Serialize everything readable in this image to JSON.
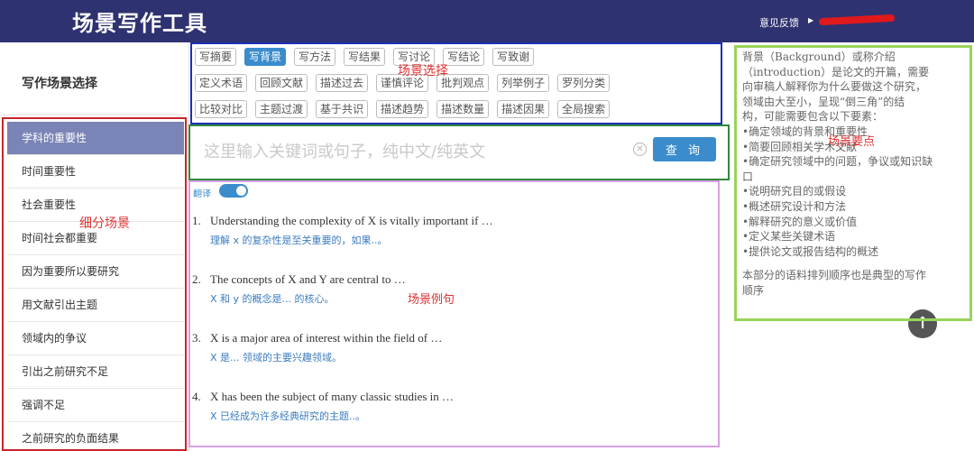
{
  "header": {
    "title": "场景写作工具",
    "feedback": "意见反馈"
  },
  "sidebar": {
    "title": "写作场景选择",
    "items": [
      {
        "label": "学科的重要性",
        "active": true
      },
      {
        "label": "时间重要性"
      },
      {
        "label": "社会重要性"
      },
      {
        "label": "时间社会都重要"
      },
      {
        "label": "因为重要所以要研究"
      },
      {
        "label": "用文献引出主题"
      },
      {
        "label": "领域内的争议"
      },
      {
        "label": "引出之前研究不足"
      },
      {
        "label": "强调不足"
      },
      {
        "label": "之前研究的负面结果"
      }
    ]
  },
  "chips": [
    [
      {
        "label": "写摘要"
      },
      {
        "label": "写背景",
        "active": true
      },
      {
        "label": "写方法"
      },
      {
        "label": "写结果"
      },
      {
        "label": "写讨论"
      },
      {
        "label": "写结论"
      },
      {
        "label": "写致谢"
      }
    ],
    [
      {
        "label": "定义术语"
      },
      {
        "label": "回顾文献"
      },
      {
        "label": "描述过去"
      },
      {
        "label": "谨慎评论"
      },
      {
        "label": "批判观点"
      },
      {
        "label": "列举例子"
      },
      {
        "label": "罗列分类"
      }
    ],
    [
      {
        "label": "比较对比"
      },
      {
        "label": "主题过渡"
      },
      {
        "label": "基于共识"
      },
      {
        "label": "描述趋势"
      },
      {
        "label": "描述数量"
      },
      {
        "label": "描述因果"
      },
      {
        "label": "全局搜索"
      }
    ]
  ],
  "search": {
    "placeholder": "这里输入关键词或句子，纯中文/纯英文",
    "button": "查 询"
  },
  "translate_label": "翻译",
  "examples": [
    {
      "num": "1.",
      "en": "Understanding the complexity of X is vitally important if …",
      "zh": "理解 x 的复杂性是至关重要的，如果..。"
    },
    {
      "num": "2.",
      "en": "The concepts of X and Y are central to …",
      "zh": "X 和 y 的概念是... 的核心。"
    },
    {
      "num": "3.",
      "en": "X is a major area of interest within the field of …",
      "zh": "X 是... 领域的主要兴趣领域。"
    },
    {
      "num": "4.",
      "en": "X has been the subject of many classic studies in …",
      "zh": "X 已经成为许多经典研究的主题..。"
    }
  ],
  "right_panel": {
    "lines": [
      "背景（Background）或称介绍",
      "（introduction）是论文的开篇，需要",
      "向审稿人解释你为什么要做这个研究，",
      "领域由大至小，呈现“倒三角”的结",
      "构，可能需要包含以下要素：",
      "•确定领域的背景和重要性",
      "•简要回顾相关学术文献",
      "•确定研究领域中的问题，争议或知识缺",
      "口",
      "•说明研究目的或假设",
      "•概述研究设计和方法",
      "•解释研究的意义或价值",
      "•定义某些关键术语",
      "•提供论文或报告结构的概述"
    ],
    "note_lines": [
      "本部分的语料排列顺序也是典型的写作",
      "顺序"
    ]
  },
  "annotations": {
    "scene_select": "场景选择",
    "scene_points": "场景要点",
    "sub_scene": "细分场景",
    "scene_examples": "场景例句"
  },
  "colors": {
    "header_bg": "#2f3270",
    "accent": "#3a8ccc",
    "sidebar_active": "#7a84b7",
    "anno_red": "#e03232",
    "anno_blue": "#1c2fb5",
    "anno_green": "#2f8a3c",
    "anno_lime": "#9ad35c",
    "anno_purple": "#d9a0e6"
  }
}
